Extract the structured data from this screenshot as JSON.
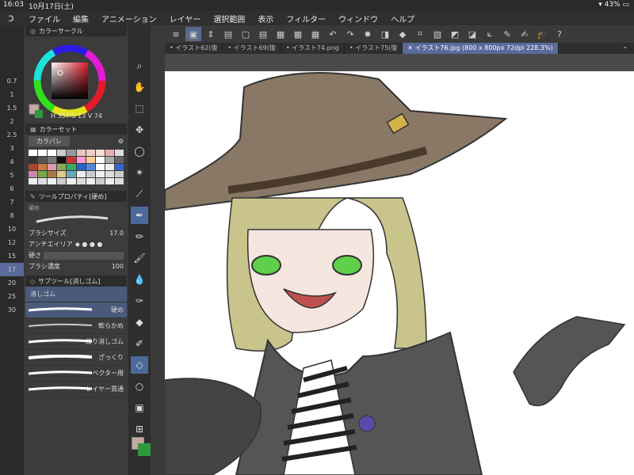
{
  "status": {
    "time": "16:03",
    "date": "10月17日(土)",
    "battery": "43%"
  },
  "menu": [
    "ファイル",
    "編集",
    "アニメーション",
    "レイヤー",
    "選択範囲",
    "表示",
    "フィルター",
    "ウィンドウ",
    "ヘルプ"
  ],
  "tabs": [
    "イラスト62(復",
    "イラスト69(復",
    "イラスト74.png",
    "イラスト75(復",
    "イラスト76.jpg (800 x 800px 72dpi 228.3%)"
  ],
  "brush_sizes": [
    "0.7",
    "1",
    "1.5",
    "2",
    "2.5",
    "3",
    "4",
    "5",
    "6",
    "7",
    "8",
    "10",
    "12",
    "15",
    "17",
    "20",
    "25",
    "30"
  ],
  "color_circle": {
    "title": "カラーサークル",
    "h": "357",
    "s": "13",
    "v": "74"
  },
  "color_set": {
    "title": "カラーセット",
    "dropdown": "カラパレ"
  },
  "tool_property": {
    "title": "ツールプロパティ[硬め]",
    "brush_tag": "硬め",
    "brush_size_label": "ブラシサイズ",
    "brush_size_value": "17.0",
    "antialias_label": "アンチエイリア",
    "hardness_label": "硬さ",
    "density_label": "ブラシ濃度",
    "density_value": "100"
  },
  "subtool": {
    "title": "サブツール[消しゴム]",
    "group": "消しゴム",
    "items": [
      "硬め",
      "軟らかめ",
      "練り消しゴム",
      "ざっくり",
      "ベクター用",
      "レイヤー貫通"
    ]
  },
  "colors": {
    "accent": "#5a6a9a",
    "fg": "#c4a8a2",
    "bg": "#2e9a3e"
  }
}
